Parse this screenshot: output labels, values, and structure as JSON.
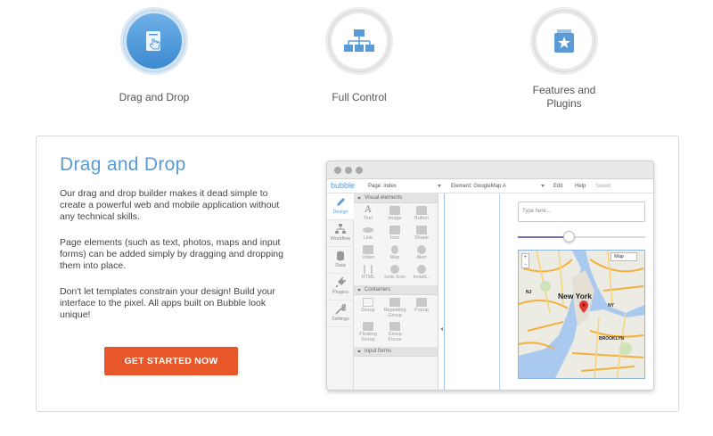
{
  "features": [
    {
      "label": "Drag and Drop",
      "icon": "hand-pointer-icon",
      "active": true
    },
    {
      "label": "Full Control",
      "icon": "sitemap-icon",
      "active": false
    },
    {
      "label": "Features and Plugins",
      "icon": "plugin-star-icon",
      "active": false
    }
  ],
  "panel": {
    "title": "Drag and Drop",
    "paragraphs": [
      "Our drag and drop builder makes it dead simple to create a powerful web and mobile application without any technical skills.",
      "Page elements (such as text, photos, maps and input forms) can be added simply by dragging and dropping them into place.",
      "Don't let templates constrain your design! Build your interface to the pixel. All apps built on Bubble look unique!"
    ],
    "cta_label": "GET STARTED NOW"
  },
  "editor": {
    "logo": "bubble",
    "page_label": "Page: index",
    "element_label": "Element: GoogleMap A",
    "menu": {
      "edit": "Edit",
      "help": "Help",
      "saved": "Saved"
    },
    "nav": [
      {
        "label": "Design",
        "icon": "pencil-icon",
        "active": true
      },
      {
        "label": "Workflow",
        "icon": "workflow-icon",
        "active": false
      },
      {
        "label": "Data",
        "icon": "database-icon",
        "active": false
      },
      {
        "label": "Plugins",
        "icon": "plug-icon",
        "active": false
      },
      {
        "label": "Settings",
        "icon": "wrench-icon",
        "active": false
      }
    ],
    "sections": {
      "visual": "Visual elements",
      "containers": "Containers",
      "input_forms": "Input forms"
    },
    "visual_elements": [
      {
        "label": "Text",
        "glyph": "A"
      },
      {
        "label": "Image",
        "glyph": ""
      },
      {
        "label": "Button",
        "glyph": ""
      },
      {
        "label": "Link",
        "glyph": ""
      },
      {
        "label": "Icon",
        "glyph": ""
      },
      {
        "label": "Shape",
        "glyph": ""
      },
      {
        "label": "Video",
        "glyph": ""
      },
      {
        "label": "Map",
        "glyph": ""
      },
      {
        "label": "Alert",
        "glyph": ""
      },
      {
        "label": "HTML",
        "glyph": ""
      },
      {
        "label": "Ionic Icon",
        "glyph": ""
      },
      {
        "label": "Install...",
        "glyph": ""
      }
    ],
    "containers": [
      {
        "label": "Group"
      },
      {
        "label": "Repeating Group"
      },
      {
        "label": "Popup"
      },
      {
        "label": "Floating Group"
      },
      {
        "label": "Group Focus"
      }
    ],
    "input_placeholder": "Type here...",
    "slider_value": 0.4,
    "map": {
      "type_label": "Map",
      "zoom_in": "+",
      "zoom_out": "−",
      "labels": {
        "city": "New York",
        "brooklyn": "BROOKLYN",
        "nj": "NJ",
        "ny": "NY"
      }
    }
  },
  "colors": {
    "accent": "#5b9bd5",
    "cta": "#e8572a",
    "slider": "#7c6bb7"
  }
}
